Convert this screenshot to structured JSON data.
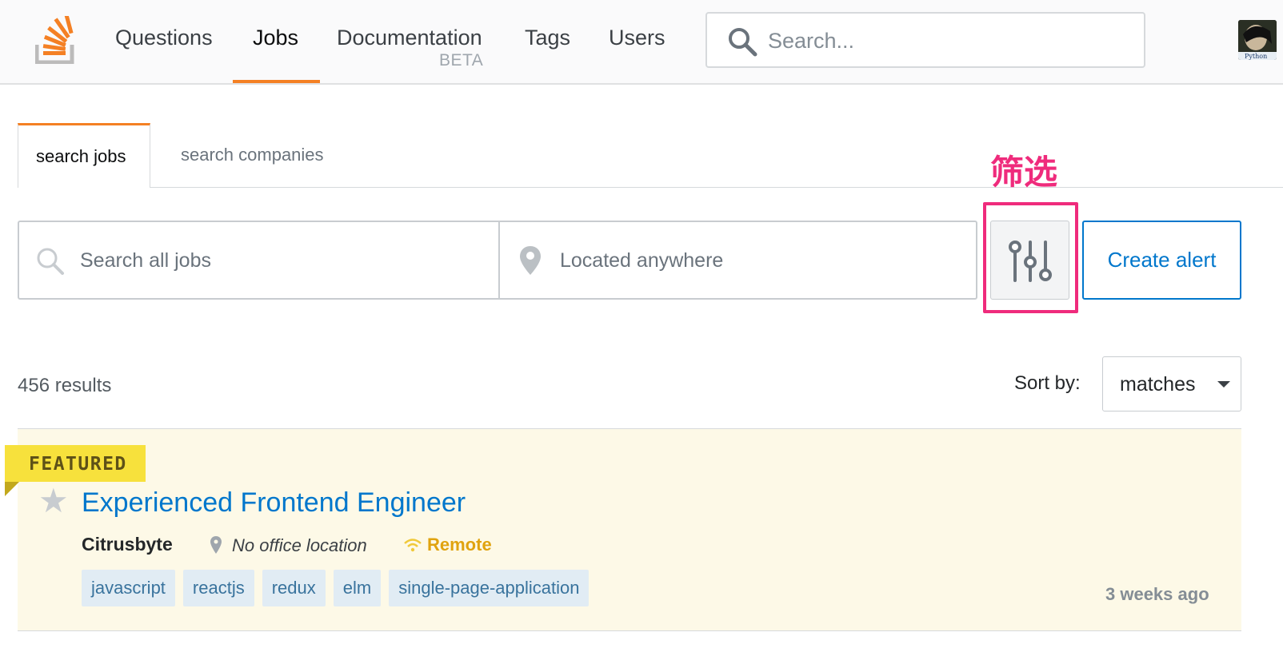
{
  "header": {
    "nav": [
      {
        "label": "Questions"
      },
      {
        "label": "Jobs"
      },
      {
        "label": "Documentation"
      },
      {
        "label": "Tags"
      },
      {
        "label": "Users"
      }
    ],
    "documentation_badge": "BETA",
    "search_placeholder": "Search...",
    "icons": {
      "logo": "stackoverflow-logo",
      "search": "search-icon",
      "avatar": "user-avatar"
    }
  },
  "tabs": {
    "active": "search jobs",
    "other": "search companies"
  },
  "annotation": {
    "label": "筛选",
    "color": "#ef2b7c"
  },
  "search": {
    "jobs_placeholder": "Search all jobs",
    "location_placeholder": "Located anywhere",
    "filter_icon": "sliders-icon",
    "create_alert": "Create alert"
  },
  "results": {
    "count_text": "456 results",
    "sort_label": "Sort by:",
    "sort_value": "matches"
  },
  "job": {
    "badge": "FEATURED",
    "title": "Experienced Frontend Engineer",
    "company": "Citrusbyte",
    "location": "No office location",
    "remote": "Remote",
    "tags": [
      "javascript",
      "reactjs",
      "redux",
      "elm",
      "single-page-application"
    ],
    "posted": "3 weeks ago"
  },
  "colors": {
    "accent": "#f48024",
    "link": "#0077cc",
    "featured_bg": "#fdf9e7",
    "featured_badge": "#f7e13c",
    "remote": "#e0a30f",
    "tag_bg": "#e1ecf4",
    "tag_text": "#39739d"
  }
}
